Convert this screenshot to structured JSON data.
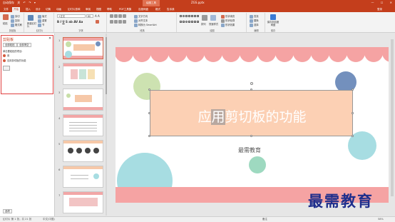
{
  "titlebar": {
    "quick_access": [
      "自动保存",
      "关",
      "↶",
      "↷",
      "▾"
    ],
    "context_tab": "绘图工具",
    "document_title": "ZGS.pptx",
    "login": "登录",
    "window_buttons": [
      "—",
      "☐",
      "✕"
    ]
  },
  "tabs": [
    "文件",
    "开始",
    "插入",
    "设计",
    "切换",
    "动画",
    "幻灯片放映",
    "审阅",
    "视图",
    "帮助",
    "PDF工具集",
    "百度网盘",
    "格式",
    "告诉我"
  ],
  "active_tab": "开始",
  "ribbon": {
    "clipboard": {
      "paste": "粘贴",
      "cut": "剪切",
      "copy": "复制",
      "format": "格式刷",
      "label": "剪贴板"
    },
    "slides": {
      "new": "新建幻灯片",
      "layout": "版式",
      "reset": "重置",
      "section": "节",
      "label": "幻灯片"
    },
    "font": {
      "name": "+正文",
      "size": "60",
      "label": "字体"
    },
    "paragraph": {
      "label": "段落",
      "text_direction": "文字方向",
      "align_text": "对齐文本",
      "smartart": "转换为 SmartArt"
    },
    "drawing": {
      "label": "绘图",
      "arrange": "排列",
      "quick_styles": "快速样式",
      "fill": "形状填充",
      "outline": "形状轮廓",
      "effects": "形状效果"
    },
    "editing": {
      "label": "编辑",
      "find": "查找",
      "replace": "替换",
      "select": "选择"
    },
    "save": {
      "label": "保存",
      "button": "保存到百度网盘"
    }
  },
  "clipboard_pane": {
    "title": "剪贴板",
    "close": "✕",
    "paste_all": "全部粘贴",
    "clear_all": "全部清空",
    "hint": "单击要粘贴的项目:",
    "items": [
      "用",
      "应用剪切板的功能"
    ],
    "options": "选项"
  },
  "thumbnails": {
    "numbers": [
      "1",
      "2",
      "3",
      "4",
      "5",
      "6",
      "7"
    ],
    "selected": "1"
  },
  "slide": {
    "title_before": "应",
    "title_highlight": "用",
    "title_after": "剪切板的功能",
    "subtitle": "最需教育",
    "colors": {
      "green": "#c8dfa8",
      "blue": "#7390bd",
      "cyan": "#a7dde2",
      "teal": "#9ed9c0",
      "pink": "#f5a3a3",
      "peach": "#fcd0b4"
    }
  },
  "statusbar": {
    "slide_info": "幻灯片 第 1 张，共 21 张",
    "language": "中文(中国)",
    "notes": "备注",
    "zoom": "58%"
  },
  "watermark": "最需教育"
}
